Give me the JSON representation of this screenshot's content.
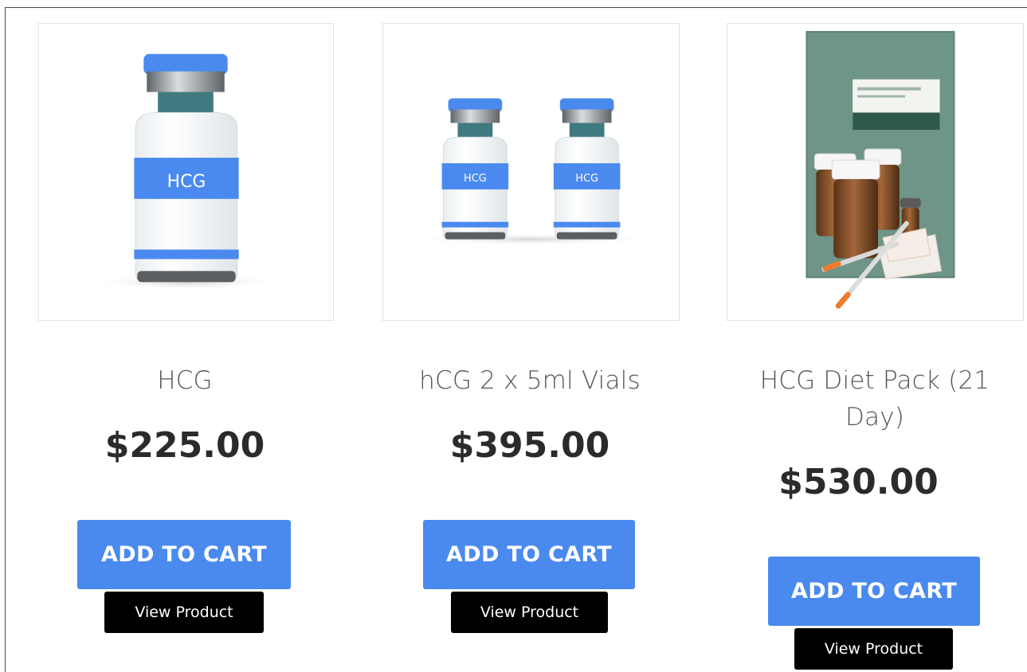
{
  "products": [
    {
      "image_label": "HCG",
      "title": "HCG",
      "price": "$225.00",
      "add_to_cart_label": "ADD TO CART",
      "view_product_label": "View Product"
    },
    {
      "image_label": "HCG",
      "title": "hCG 2 x 5ml Vials",
      "price": "$395.00",
      "add_to_cart_label": "ADD TO CART",
      "view_product_label": "View Product"
    },
    {
      "title": "HCG Diet Pack (21 Day)",
      "price": "$530.00",
      "add_to_cart_label": "ADD TO CART",
      "view_product_label": "View Product"
    }
  ],
  "colors": {
    "button_accent": "#4a8aef",
    "view_button": "#000000",
    "vial_cap": "#4a8aef",
    "box_green": "#6f9488"
  }
}
